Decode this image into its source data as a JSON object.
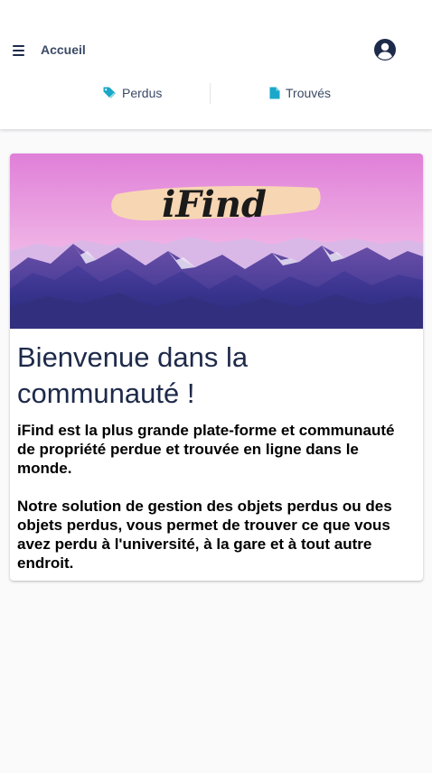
{
  "header": {
    "title": "Accueil",
    "menu_icon": "hamburger-menu-icon",
    "user_icon": "user-circle-icon"
  },
  "tabs": [
    {
      "label": "Perdus",
      "icon": "tag-icon"
    },
    {
      "label": "Trouvés",
      "icon": "file-icon"
    }
  ],
  "card": {
    "banner_logo": "iFind",
    "title": "Bienvenue dans la communauté !",
    "paragraph1": "iFind est la plus grande plate-forme et communauté de propriété perdue et trouvée en ligne dans le monde.",
    "paragraph2": "Notre solution de gestion des objets perdus ou des objets perdus, vous permet de trouver ce que vous avez perdu à l'université, à la gare et à tout autre endroit."
  },
  "colors": {
    "accent": "#1aa7c9",
    "navy": "#1e2a4a",
    "header_text": "#3b4a66"
  }
}
